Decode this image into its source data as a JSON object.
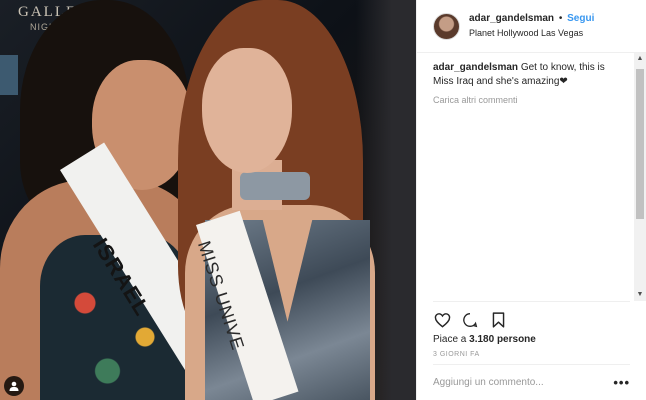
{
  "photo": {
    "sign_line1": "GALLERY",
    "sign_line2": "NIGHTCLUB",
    "sash_left": "ISRAEL",
    "sash_right": "MISS UNIVE",
    "tag_icon": "person-tag-icon"
  },
  "header": {
    "username": "adar_gandelsman",
    "separator": "•",
    "follow_label": "Segui",
    "location": "Planet Hollywood Las Vegas"
  },
  "caption": {
    "username": "adar_gandelsman",
    "text": "Get to know, this is Miss Iraq and she's amazing",
    "emoji": "❤"
  },
  "load_more": "Carica altri commenti",
  "actions": {
    "like_icon": "heart-icon",
    "comment_icon": "comment-bubble-icon",
    "save_icon": "bookmark-icon"
  },
  "likes": {
    "prefix": "Piace a ",
    "count": "3.180",
    "suffix": " persone"
  },
  "timestamp": "3 GIORNI FA",
  "add_comment": {
    "placeholder": "Aggiungi un commento...",
    "options": "•••"
  },
  "colors": {
    "link_blue": "#3897f0",
    "text": "#262626",
    "muted": "#999999",
    "border": "#efefef"
  }
}
